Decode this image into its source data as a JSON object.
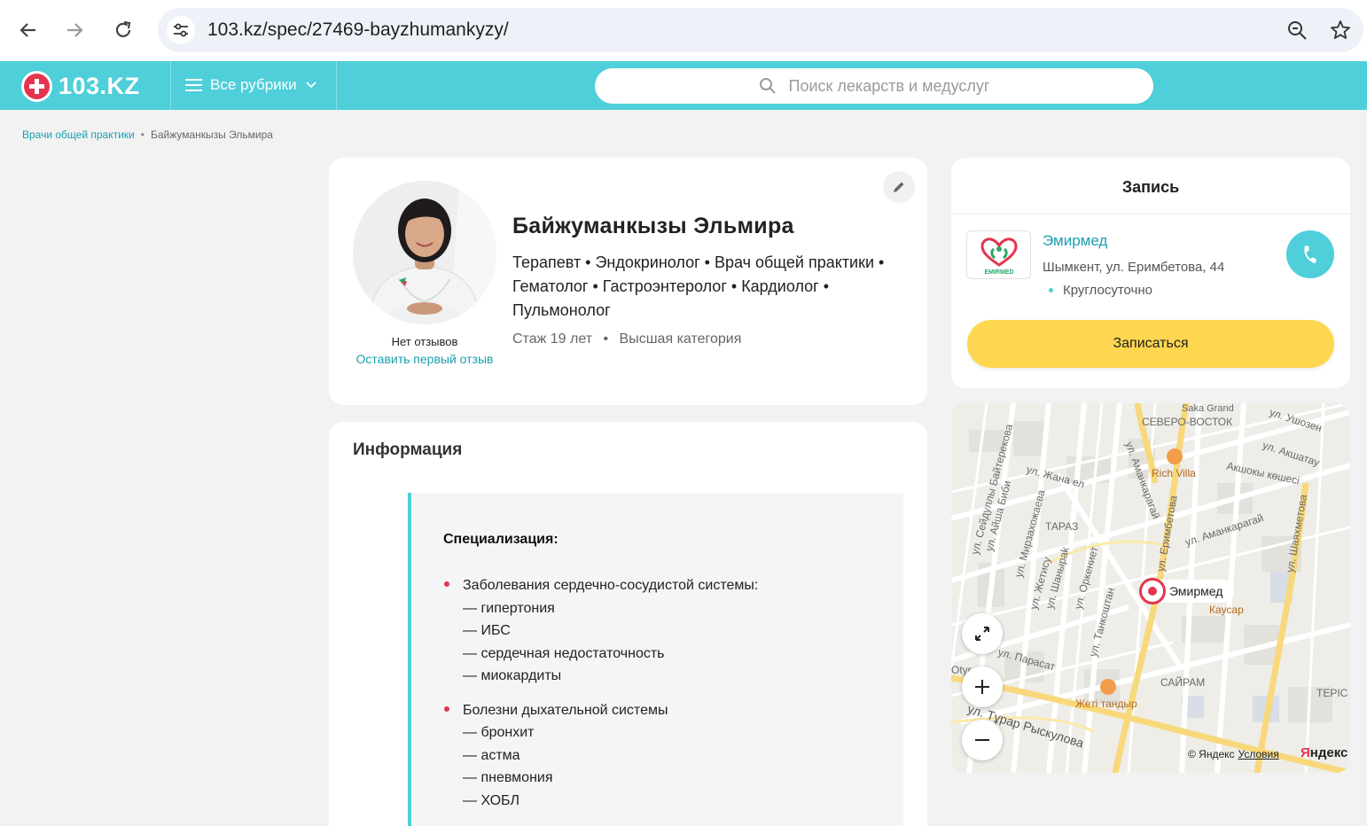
{
  "browser": {
    "url": "103.kz/spec/27469-bayzhumankyzy/"
  },
  "header": {
    "logo_text": "103.KZ",
    "rubrics_label": "Все рубрики",
    "search_placeholder": "Поиск лекарств и медуслуг",
    "accent_color": "#4ecfd9"
  },
  "breadcrumb": {
    "parent": "Врачи общей практики",
    "separator": "•",
    "current": "Байжуманкызы Эльмира"
  },
  "doctor": {
    "name": "Байжуманкызы Эльмира",
    "specialties": "Терапевт • Эндокринолог • Врач общей практики • Гематолог • Гастроэнтеролог • Кардиолог • Пульмонолог",
    "experience": "Стаж 19 лет",
    "separator": "•",
    "category": "Высшая категория",
    "reviews_text": "Нет отзывов",
    "first_review_link": "Оставить первый отзыв"
  },
  "info": {
    "title": "Информация",
    "heading": "Специализация:",
    "groups": [
      {
        "title": "Заболевания сердечно-сосудистой системы:",
        "items": [
          "— гипертония",
          "— ИБС",
          "— сердечная недостаточность",
          "— миокардиты"
        ]
      },
      {
        "title": "Болезни дыхательной системы",
        "items": [
          "— бронхит",
          "— астма",
          "— пневмония",
          "— ХОБЛ"
        ]
      }
    ]
  },
  "booking": {
    "title": "Запись",
    "clinic_name": "Эмирмед",
    "clinic_logo_text": "EMIRMED",
    "clinic_address": "Шымкент, ул. Еримбетова, 44",
    "hours": "Круглосуточно",
    "button_label": "Записаться",
    "button_color": "#ffd64f"
  },
  "map": {
    "pin_label": "Эмирмед",
    "copyright": "© Яндекс",
    "terms": "Условия",
    "brand_first": "Я",
    "brand_rest": "ндекс",
    "labels": [
      "Saka Grand",
      "СЕВЕРО-ВОСТОК",
      "ул. Ушозен",
      "ул. Акшатау",
      "Акшокы көшесі",
      "Rich Villa",
      "ул. Жана ел",
      "ул. Аманкарагай",
      "ул. Сейдуллы Байтерекова",
      "ул. Айша Биби",
      "ул. Мирзахожаева",
      "ТАРАЗ",
      "ул. Жетису",
      "ул. Шаныраk",
      "ул. Оркениет",
      "ул. Танкоштан",
      "ул. Аманкарагай",
      "ул. Еримбетова",
      "ул. Шаяхметова",
      "Каусар",
      "ул. Парасат",
      "САЙРАМ",
      "Жеті тандыр",
      "ул. Тұрар Рыскулова",
      "ТЕРІС",
      "Otyr"
    ]
  }
}
